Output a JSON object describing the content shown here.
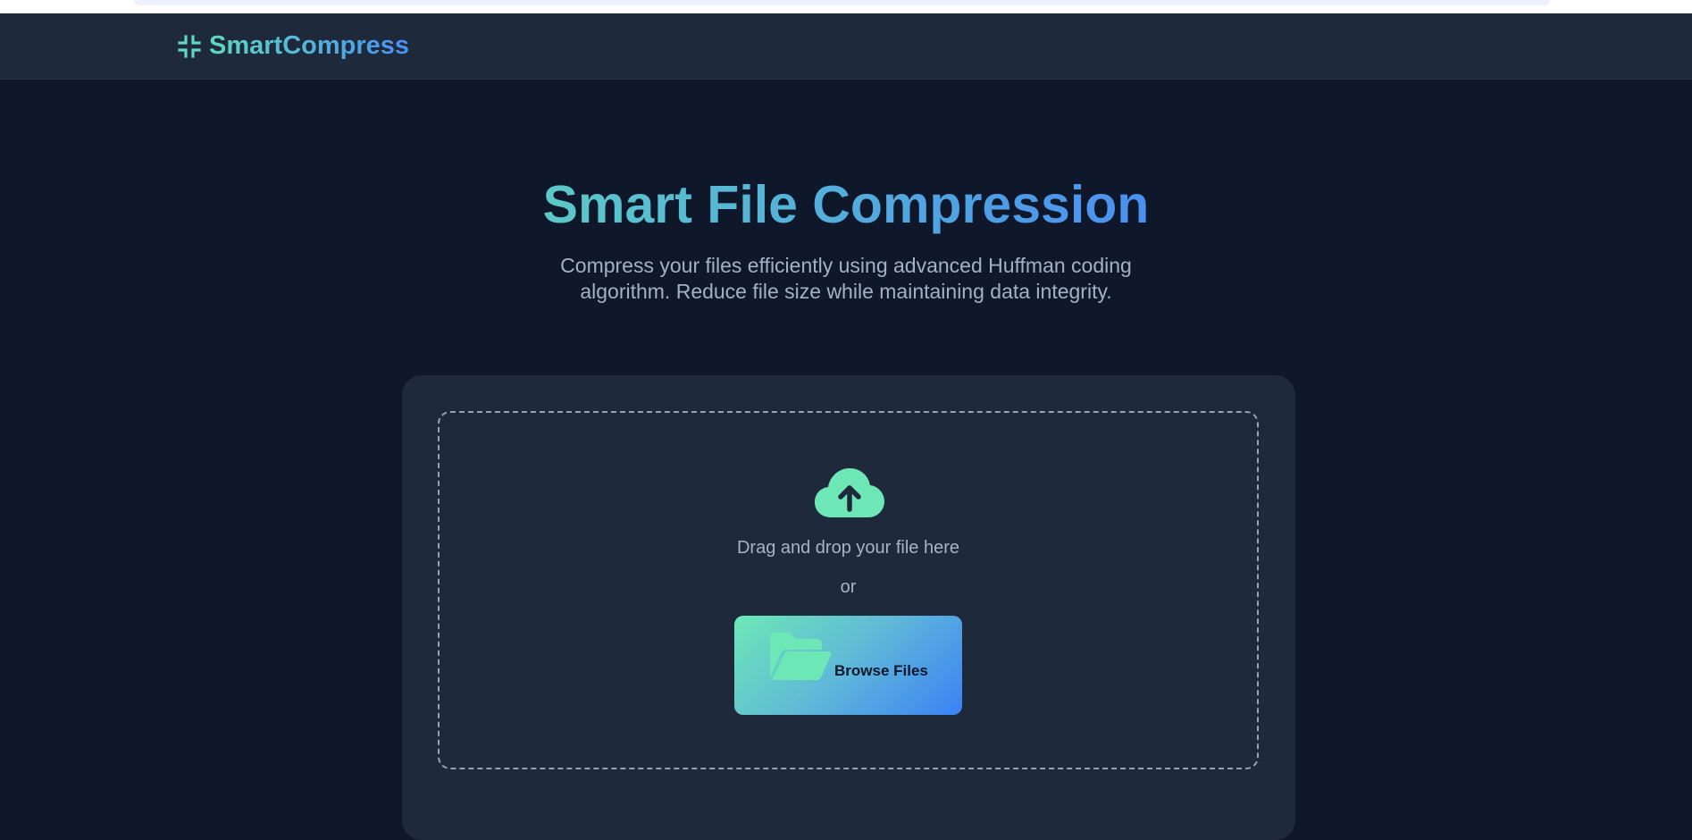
{
  "navbar": {
    "brand_name": "SmartCompress",
    "brand_icon": "compress-icon"
  },
  "hero": {
    "title": "Smart File Compression",
    "subtitle": "Compress your files efficiently using advanced Huffman coding algorithm. Reduce file size while maintaining data integrity."
  },
  "upload": {
    "icon": "cloud-upload-icon",
    "drop_text": "Drag and drop your file here",
    "or_text": "or",
    "browse_icon": "folder-open-icon",
    "browse_label": "Browse Files"
  },
  "colors": {
    "page_background": "#0f172a",
    "card_background": "#1e293b",
    "accent_start": "#6ee7b7",
    "accent_end": "#3b82f6"
  }
}
